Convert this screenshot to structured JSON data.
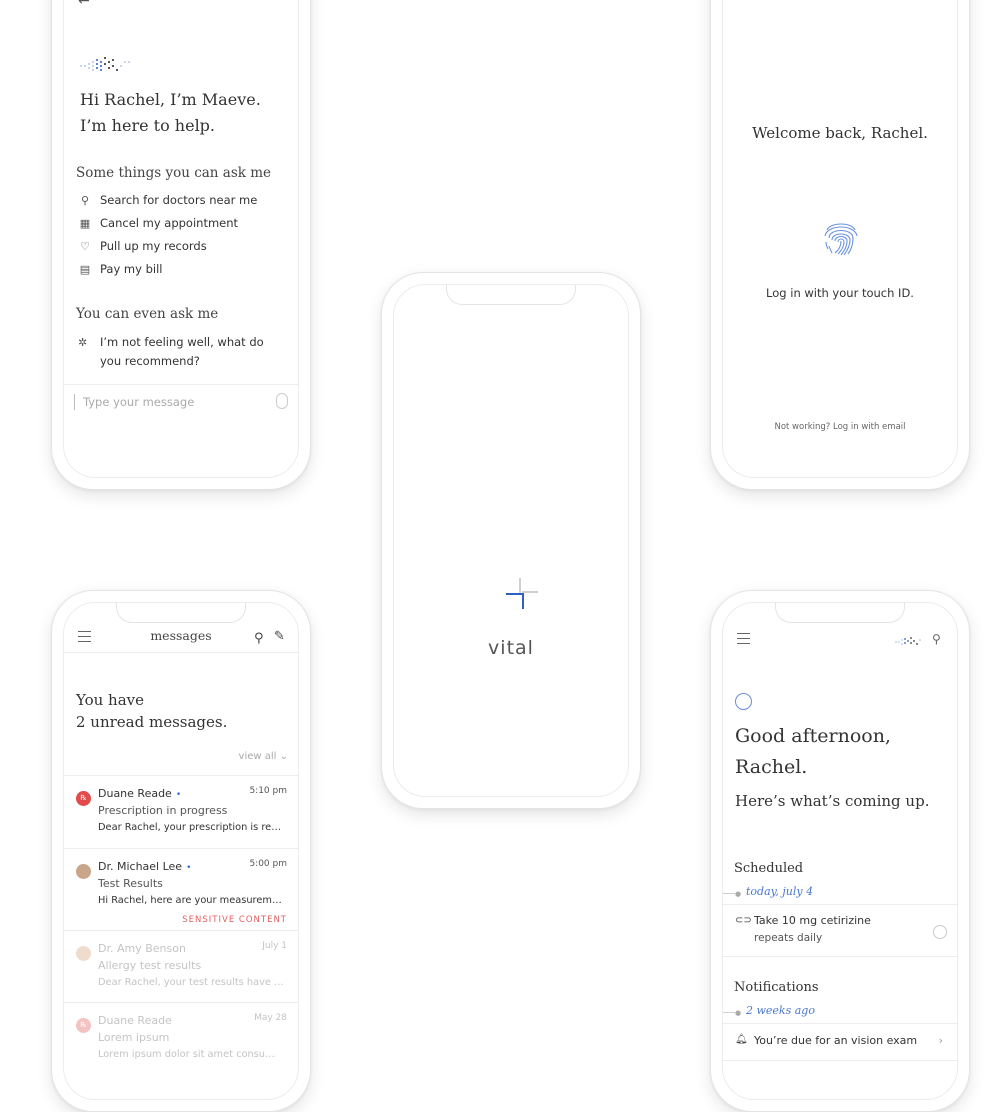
{
  "assistant": {
    "back_icon": "←",
    "greeting_line1": "Hi Rachel, I’m Maeve.",
    "greeting_line2": "I’m here to help.",
    "ask_heading": "Some things you can ask me",
    "suggestions": [
      {
        "icon": "search-icon",
        "label": "Search for doctors near me"
      },
      {
        "icon": "calendar-icon",
        "label": "Cancel my appointment"
      },
      {
        "icon": "records-icon",
        "label": "Pull up my records"
      },
      {
        "icon": "bill-icon",
        "label": "Pay my bill"
      }
    ],
    "even_heading": "You can even ask me",
    "even_item": "I’m not feeling well, what do you recommend?",
    "input_placeholder": "Type your message"
  },
  "splash": {
    "wordmark": "vital"
  },
  "touch": {
    "welcome": "Welcome back, Rachel.",
    "touch_label": "Log in with your touch ID.",
    "email_link": "Not working? Log in with email"
  },
  "messages": {
    "title": "messages",
    "unread_line1": "You have",
    "unread_line2": "2 unread messages.",
    "view_all": "view all ⌄",
    "items": [
      {
        "sender": "Duane Reade",
        "unread": "•",
        "time": "5:10 pm",
        "subject": "Prescription in progress",
        "preview": "Dear Rachel, your prescription is ready for pickup",
        "tag": ""
      },
      {
        "sender": "Dr. Michael Lee",
        "unread": "•",
        "time": "5:00 pm",
        "subject": "Test Results",
        "preview": "Hi Rachel, here are your measurements from the visit",
        "tag": "SENSITIVE CONTENT"
      },
      {
        "sender": "Dr. Amy Benson",
        "unread": "",
        "time": "July 1",
        "subject": "Allergy test results",
        "preview": "Dear Rachel, your test results have come back",
        "tag": ""
      },
      {
        "sender": "Duane Reade",
        "unread": "",
        "time": "May 28",
        "subject": "Lorem ipsum",
        "preview": "Lorem ipsum dolor sit amet consumat adipiscing",
        "tag": ""
      }
    ]
  },
  "dashboard": {
    "greeting_line1": "Good afternoon,",
    "greeting_line2": "Rachel.",
    "coming_up": "Here’s what’s coming up.",
    "scheduled_heading": "Scheduled",
    "scheduled_date": "today, july 4",
    "scheduled_item_title": "Take 10 mg cetirizine",
    "scheduled_item_sub": "repeats daily",
    "notifications_heading": "Notifications",
    "notifications_date": "2 weeks ago",
    "notification_item": "You’re due for an vision exam"
  },
  "colors": {
    "accent_blue": "#4a78d0",
    "sensitive_red": "#e06060"
  }
}
